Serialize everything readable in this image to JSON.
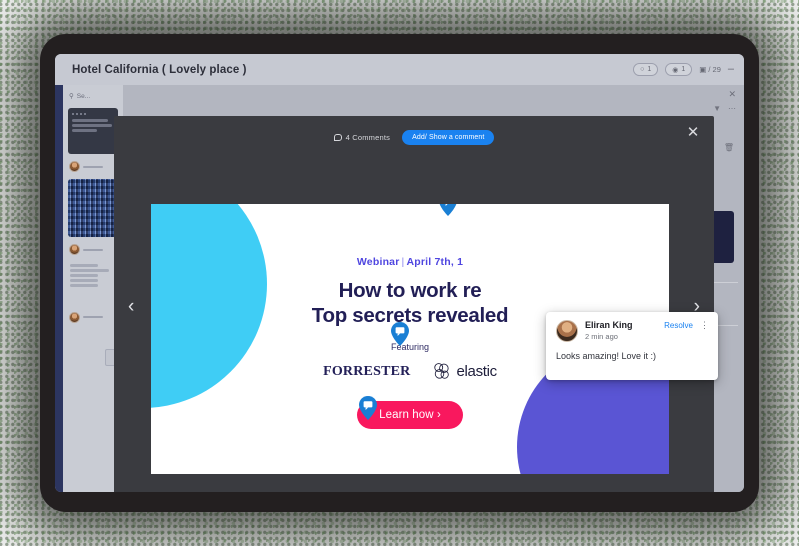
{
  "window": {
    "title": "Hotel California ( Lovely place )",
    "toolbar": {
      "badge_1": "1",
      "badge_2": "1",
      "page_counter": "/ 29",
      "minimize": "–"
    }
  },
  "sidebar": {
    "search_placeholder": "Se..."
  },
  "modal": {
    "comments_count_label": "4 Comments",
    "add_comment_button": "Add/ Show a comment",
    "close_label": "✕",
    "prev_label": "‹",
    "next_label": "›"
  },
  "slide": {
    "kicker_prefix": "Webinar",
    "kicker_separator": "|",
    "kicker_date": "April 7th, 1",
    "headline_line_1": "How to work re",
    "headline_line_2": "Top secrets revealed",
    "featuring_label": "Featuring",
    "logos": [
      {
        "name": "forrester-logo",
        "text": "FORRESTER"
      },
      {
        "name": "elastic-logo",
        "text": "elastic"
      }
    ],
    "cta_label": "Learn how ›",
    "colors": {
      "cyan": "#3fcdf5",
      "purple": "#5a55d4",
      "headline": "#221f56",
      "kicker": "#4f46e0",
      "cta": "#f9185e"
    }
  },
  "comment_popup": {
    "author": "Eliran King",
    "timestamp": "2 min ago",
    "resolve_label": "Resolve",
    "menu_label": "⋮",
    "body": "Looks amazing! Love it :)"
  },
  "pins": [
    {
      "name": "comment-pin-top"
    },
    {
      "name": "comment-pin-featuring"
    },
    {
      "name": "comment-pin-cta"
    }
  ]
}
